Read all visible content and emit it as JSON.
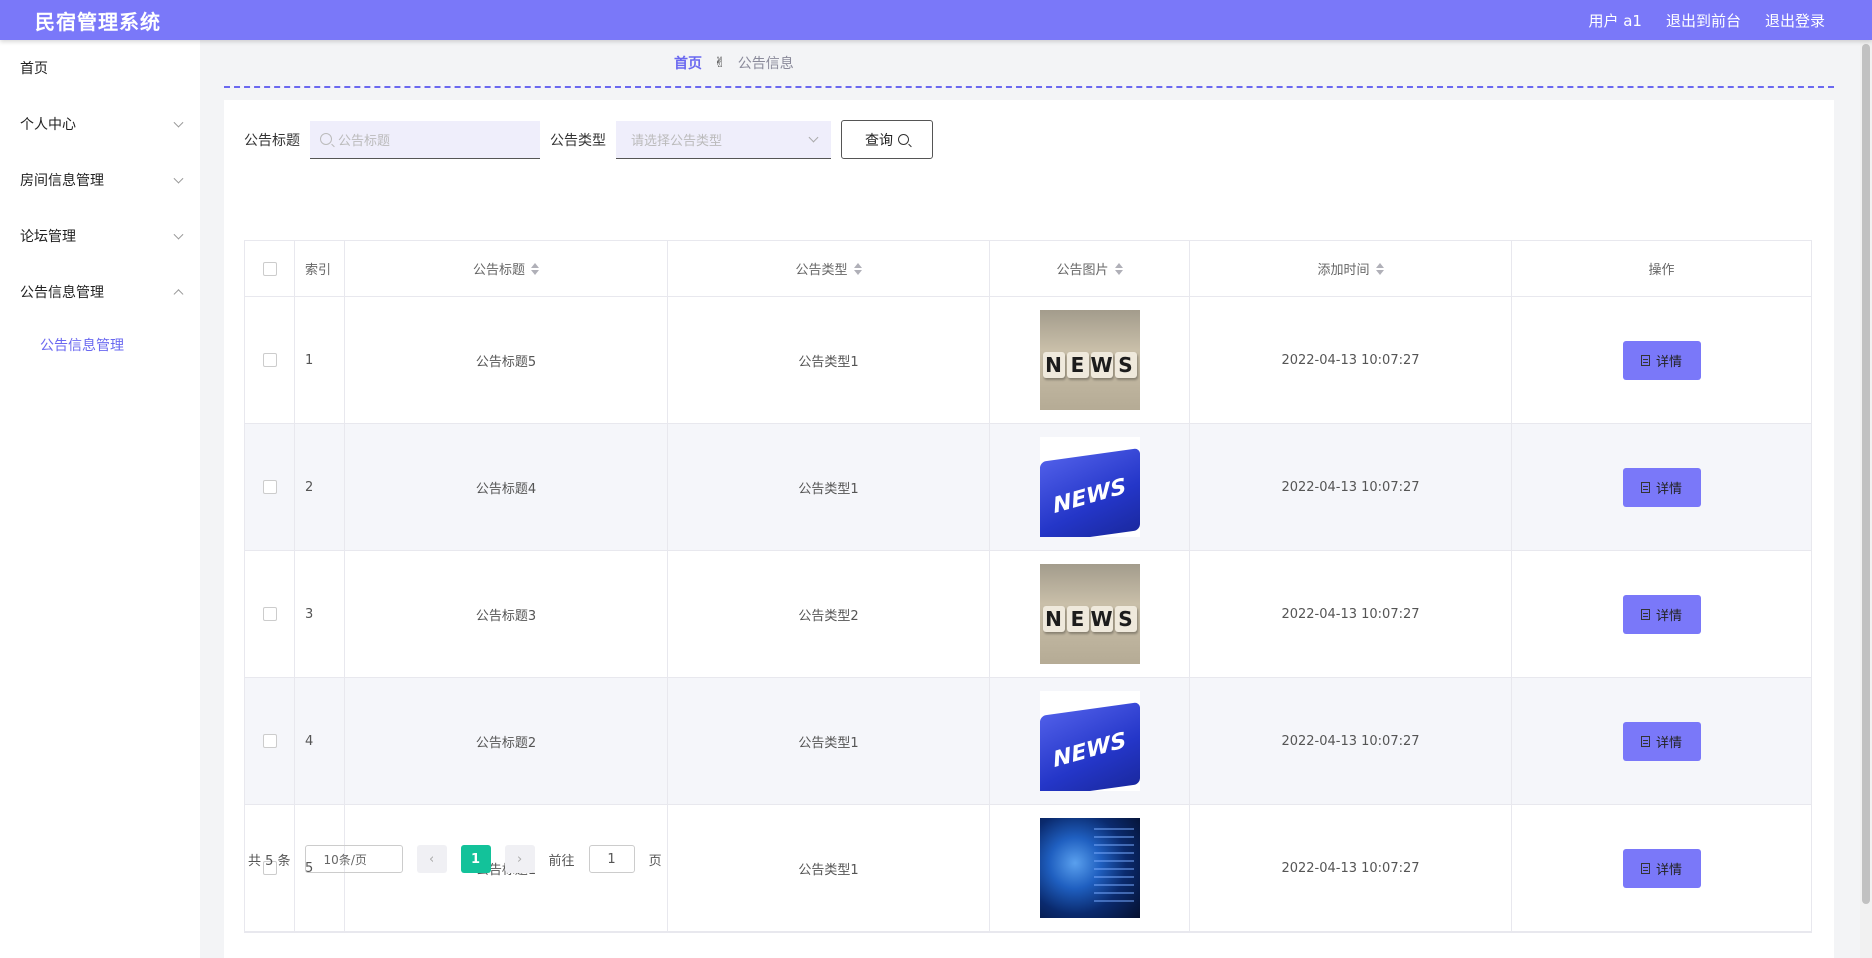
{
  "header": {
    "title": "民宿管理系统",
    "user": "用户 a1",
    "front": "退出到前台",
    "logout": "退出登录"
  },
  "sidebar": {
    "items": [
      {
        "label": "首页"
      },
      {
        "label": "个人中心"
      },
      {
        "label": "房间信息管理"
      },
      {
        "label": "论坛管理"
      },
      {
        "label": "公告信息管理"
      }
    ],
    "sub_active": "公告信息管理"
  },
  "breadcrumb": {
    "home": "首页",
    "sep": "✌",
    "current": "公告信息"
  },
  "search": {
    "title_label": "公告标题",
    "title_placeholder": "公告标题",
    "type_label": "公告类型",
    "type_placeholder": "请选择公告类型",
    "query_label": "查询"
  },
  "table": {
    "columns": [
      "索引",
      "公告标题",
      "公告类型",
      "公告图片",
      "添加时间",
      "操作"
    ],
    "rows": [
      {
        "idx": "1",
        "title": "公告标题5",
        "type": "公告类型1",
        "image": "news-dice",
        "time": "2022-04-13 10:07:27",
        "action": "详情"
      },
      {
        "idx": "2",
        "title": "公告标题4",
        "type": "公告类型1",
        "image": "news-key",
        "time": "2022-04-13 10:07:27",
        "action": "详情"
      },
      {
        "idx": "3",
        "title": "公告标题3",
        "type": "公告类型2",
        "image": "news-dice",
        "time": "2022-04-13 10:07:27",
        "action": "详情"
      },
      {
        "idx": "4",
        "title": "公告标题2",
        "type": "公告类型1",
        "image": "news-key",
        "time": "2022-04-13 10:07:27",
        "action": "详情"
      },
      {
        "idx": "5",
        "title": "公告标题1",
        "type": "公告类型1",
        "image": "globe",
        "time": "2022-04-13 10:07:27",
        "action": "详情"
      }
    ]
  },
  "pagination": {
    "total": "共 5 条",
    "size": "10条/页",
    "prev": "‹",
    "page": "1",
    "next": "›",
    "goto": "前往",
    "jump_value": "1",
    "unit": "页"
  },
  "colors": {
    "accent": "#7a78f9",
    "active_page": "#13c29a"
  }
}
